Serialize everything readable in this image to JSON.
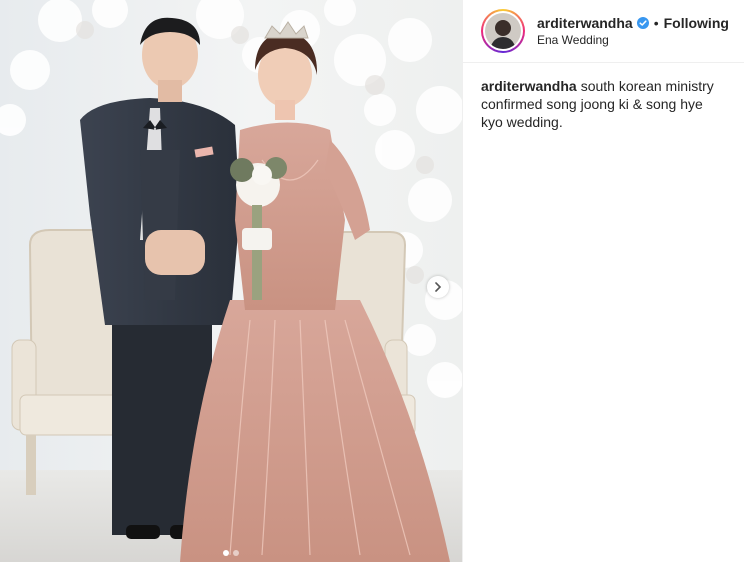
{
  "post": {
    "username": "arditerwandha",
    "verified": true,
    "separator": "•",
    "follow_status": "Following",
    "location": "Ena Wedding",
    "caption_user": "arditerwandha",
    "caption_text": "south korean ministry confirmed song joong ki & song hye kyo wedding."
  },
  "media": {
    "image_count": 2,
    "active_index": 0
  },
  "icons": {
    "verified": "verified-badge-icon",
    "next": "chevron-right-icon"
  },
  "colors": {
    "verified_blue": "#3897f0",
    "text": "#262626",
    "border": "#efefef"
  }
}
